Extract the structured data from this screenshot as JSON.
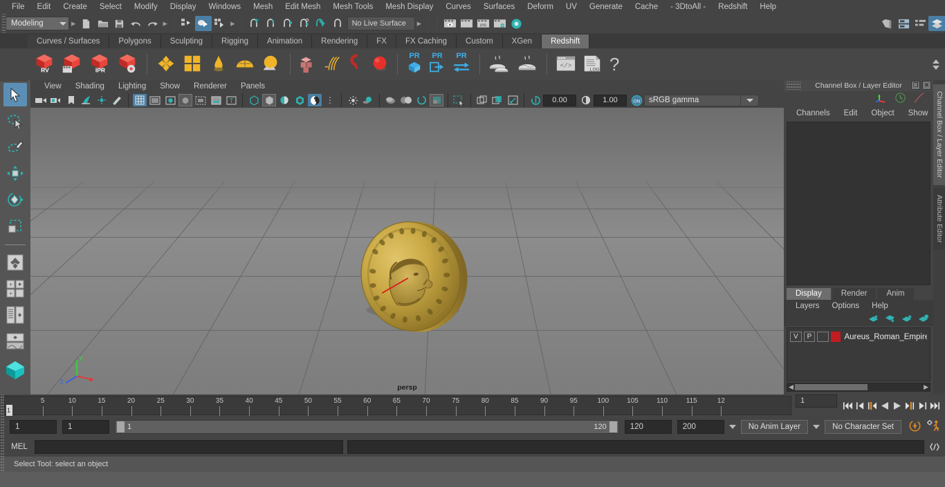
{
  "menubar": {
    "items": [
      "File",
      "Edit",
      "Create",
      "Select",
      "Modify",
      "Display",
      "Windows",
      "Mesh",
      "Edit Mesh",
      "Mesh Tools",
      "Mesh Display",
      "Curves",
      "Surfaces",
      "Deform",
      "UV",
      "Generate",
      "Cache",
      "- 3DtoAll -",
      "Redshift",
      "Help"
    ]
  },
  "statusline": {
    "menuset": "Modeling",
    "live_surface": "No Live Surface"
  },
  "shelf": {
    "tabs": [
      "Curves / Surfaces",
      "Polygons",
      "Sculpting",
      "Rigging",
      "Animation",
      "Rendering",
      "FX",
      "FX Caching",
      "Custom",
      "XGen",
      "Redshift"
    ],
    "active_tab": "Redshift",
    "buttons": [
      {
        "name": "redshift-render-view",
        "label": "RV"
      },
      {
        "name": "redshift-render-sequence",
        "label": ""
      },
      {
        "name": "redshift-ipr",
        "label": "IPR"
      },
      {
        "name": "redshift-render-settings",
        "label": ""
      },
      {
        "name": "redshift-material",
        "label": ""
      },
      {
        "name": "redshift-material-blend",
        "label": ""
      },
      {
        "name": "redshift-light-ies",
        "label": ""
      },
      {
        "name": "redshift-dome-light",
        "label": ""
      },
      {
        "name": "redshift-environment",
        "label": ""
      },
      {
        "name": "redshift-proxy",
        "label": ""
      },
      {
        "name": "redshift-hair",
        "label": ""
      },
      {
        "name": "redshift-volume",
        "label": ""
      },
      {
        "name": "redshift-sphere-light",
        "label": ""
      },
      {
        "name": "redshift-proxy-export",
        "label": "PR"
      },
      {
        "name": "redshift-proxy-import",
        "label": "PR"
      },
      {
        "name": "redshift-proxy-convert",
        "label": "PR"
      },
      {
        "name": "redshift-bake-set",
        "label": ""
      },
      {
        "name": "redshift-bake",
        "label": ""
      },
      {
        "name": "redshift-script-editor",
        "label": ""
      },
      {
        "name": "redshift-log",
        "label": ".LOG"
      },
      {
        "name": "redshift-help",
        "label": "?"
      }
    ]
  },
  "viewport_panel": {
    "menus": [
      "View",
      "Shading",
      "Lighting",
      "Show",
      "Renderer",
      "Panels"
    ],
    "exposure": "0.00",
    "gamma": "1.00",
    "view_transform": "sRGB gamma",
    "toggle_label": "ON",
    "camera_label": "persp",
    "axis": {
      "x": "x",
      "y": "y",
      "z": "z"
    }
  },
  "channel_box": {
    "title": "Channel Box / Layer Editor",
    "menus": [
      "Channels",
      "Edit",
      "Object",
      "Show"
    ]
  },
  "layer_editor": {
    "tabs": [
      "Display",
      "Render",
      "Anim"
    ],
    "active_tab": "Display",
    "menus": [
      "Layers",
      "Options",
      "Help"
    ],
    "layers": [
      {
        "visibility": "V",
        "playback": "P",
        "shading": "",
        "color": "#c21b21",
        "name": "Aureus_Roman_Empire"
      }
    ]
  },
  "right_tabs": {
    "active": "Channel Box / Layer Editor",
    "inactive": "Attribute Editor"
  },
  "timeline": {
    "labels": [
      "5",
      "10",
      "15",
      "20",
      "25",
      "30",
      "35",
      "40",
      "45",
      "50",
      "55",
      "60",
      "65",
      "70",
      "75",
      "80",
      "85",
      "90",
      "95",
      "100",
      "105",
      "110",
      "115",
      "12"
    ],
    "current_frame": "1",
    "playhead_label": "1",
    "frame_field": "1"
  },
  "range": {
    "anim_start": "1",
    "range_start": "1",
    "slider_min": "1",
    "slider_max": "120",
    "range_end": "120",
    "anim_end": "200",
    "anim_layer": "No Anim Layer",
    "character_set": "No Character Set"
  },
  "command_line": {
    "language": "MEL",
    "input_value": "",
    "output_value": ""
  },
  "help_line": {
    "text": "Select Tool: select an object"
  },
  "colors": {
    "accent_blue": "#4a7fa5",
    "teal": "#27b0b0",
    "orange": "#e08b2a",
    "redshift_red": "#d9382f",
    "gold": "#f0b429"
  }
}
